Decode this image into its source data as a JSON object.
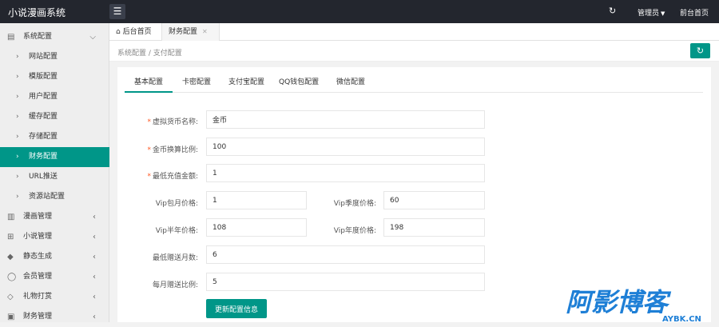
{
  "app_title": "小说漫画系统",
  "header": {
    "admin_label": "管理员",
    "front_label": "前台首页"
  },
  "sidebar": {
    "system_config": "系统配置",
    "sub_items": [
      "网站配置",
      "模版配置",
      "用户配置",
      "缓存配置",
      "存储配置",
      "财务配置",
      "URL推送",
      "资源站配置"
    ],
    "groups": [
      "漫画管理",
      "小说管理",
      "静态生成",
      "会员管理",
      "礼物打赏",
      "财务管理"
    ]
  },
  "tabs": {
    "home": "后台首页",
    "finance": "财务配置"
  },
  "breadcrumb": "系统配置 / 支付配置",
  "subtabs": [
    "基本配置",
    "卡密配置",
    "支付宝配置",
    "QQ钱包配置",
    "微信配置"
  ],
  "form": {
    "currency_name_label": "虚拟货币名称:",
    "currency_name_value": "金币",
    "exchange_ratio_label": "金币换算比例:",
    "exchange_ratio_value": "100",
    "min_recharge_label": "最低充值金额:",
    "min_recharge_value": "1",
    "vip_month_label": "Vip包月价格:",
    "vip_month_value": "1",
    "vip_quarter_label": "Vip季度价格:",
    "vip_quarter_value": "60",
    "vip_half_label": "Vip半年价格:",
    "vip_half_value": "108",
    "vip_year_label": "Vip年度价格:",
    "vip_year_value": "198",
    "min_gift_months_label": "最低赠送月数:",
    "min_gift_months_value": "6",
    "monthly_gift_ratio_label": "每月赠送比例:",
    "monthly_gift_ratio_value": "5",
    "submit_label": "更新配置信息"
  },
  "watermark": {
    "main": "阿影博客",
    "sub": "AYBK.CN"
  },
  "colors": {
    "accent": "#009688",
    "topbar": "#23262e",
    "required": "#ff5722",
    "watermark": "#1e7fd6"
  }
}
